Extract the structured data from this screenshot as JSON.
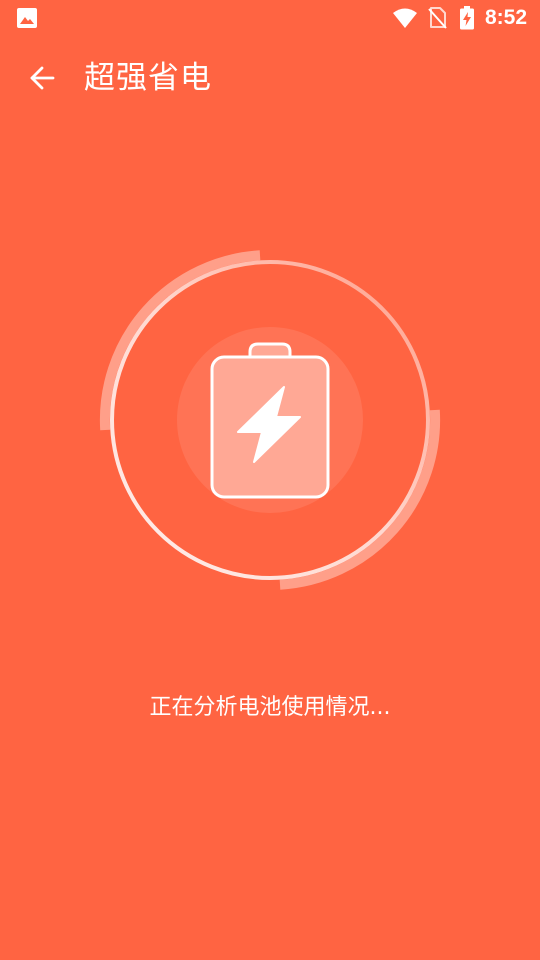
{
  "status_bar": {
    "time": "8:52",
    "icons": [
      "gallery-icon",
      "wifi-icon",
      "no-sim-icon",
      "battery-charging-icon"
    ]
  },
  "app_bar": {
    "back_icon": "arrow-left-icon",
    "title": "超强省电"
  },
  "scanner": {
    "icon": "battery-bolt-icon"
  },
  "status_text": "正在分析电池使用情况...",
  "colors": {
    "background": "#FF6442",
    "foreground": "#FFFFFF"
  }
}
